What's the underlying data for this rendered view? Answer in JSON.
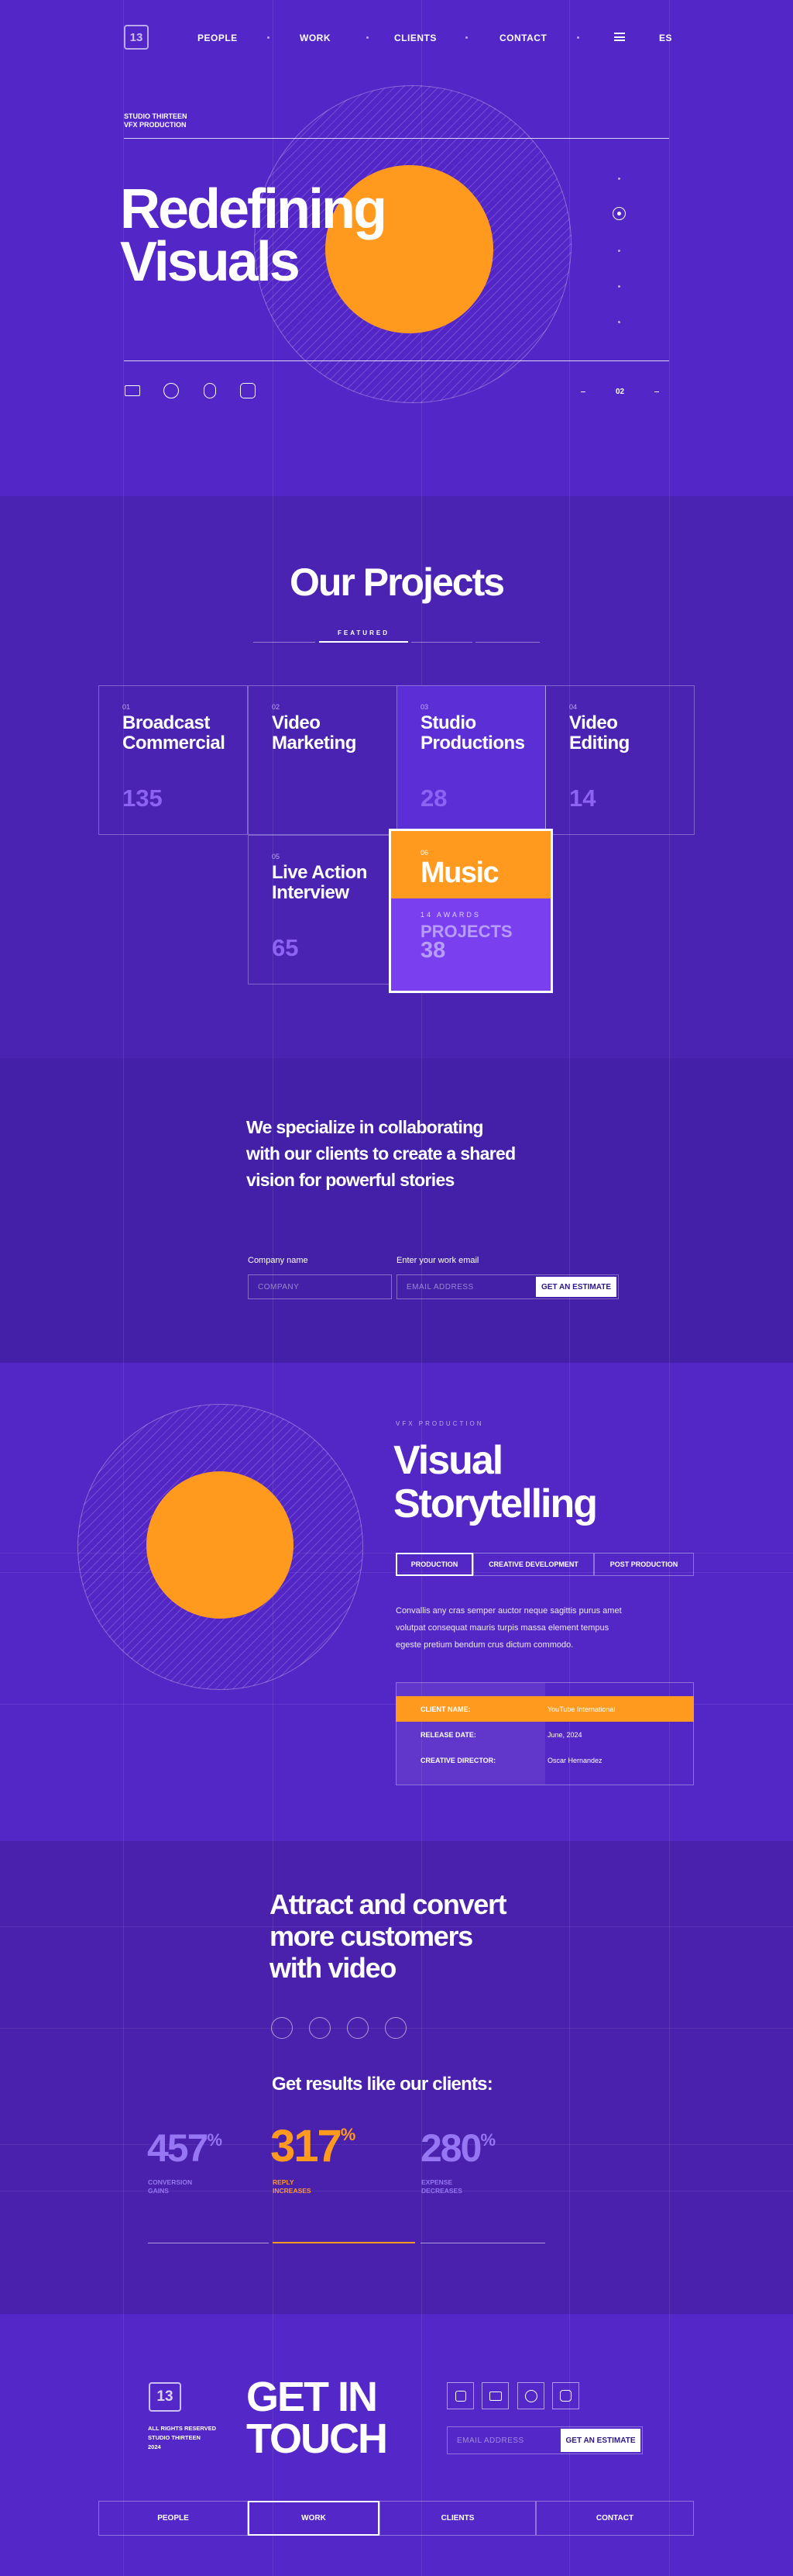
{
  "brand": {
    "logo": "13",
    "lang": "ES"
  },
  "nav": {
    "people": "PEOPLE",
    "work": "WORK",
    "clients": "CLIENTS",
    "contact": "CONTACT"
  },
  "hero": {
    "studio_line1": "STUDIO THIRTEEN",
    "studio_line2": "VFX PRODUCTION",
    "title_line1": "Redefining",
    "title_line2": "Visuals",
    "pager": "02"
  },
  "projects": {
    "heading": "Our Projects",
    "tab_label": "FEATURED",
    "cards": [
      {
        "num": "01",
        "title_line1": "Broadcast",
        "title_line2": "Commercial",
        "count": "135"
      },
      {
        "num": "02",
        "title_line1": "Video",
        "title_line2": "Marketing",
        "count": ""
      },
      {
        "num": "03",
        "title_line1": "Studio",
        "title_line2": "Productions",
        "count": "28"
      },
      {
        "num": "04",
        "title_line1": "Video",
        "title_line2": "Editing",
        "count": "14"
      },
      {
        "num": "05",
        "title_line1": "Live Action",
        "title_line2": "Interview",
        "count": "65"
      }
    ],
    "featured": {
      "num": "06",
      "title": "Music",
      "awards": "14 AWARDS",
      "projects_label": "PROJECTS",
      "projects_count": "38"
    }
  },
  "collab": {
    "text_line1": "We specialize in collaborating",
    "text_line2": "with our clients to create a shared",
    "text_line3": "vision for powerful stories",
    "company_label": "Company name",
    "company_placeholder": "COMPANY",
    "email_label": "Enter your work email",
    "email_placeholder": "EMAIL ADDRESS",
    "button": "GET AN ESTIMATE"
  },
  "story": {
    "eyebrow": "VFX PRODUCTION",
    "title_line1": "Visual",
    "title_line2": "Storytelling",
    "tabs": [
      "PRODUCTION",
      "CREATIVE DEVELOPMENT",
      "POST PRODUCTION"
    ],
    "body_line1": "Convallis any cras semper auctor neque sagittis purus amet",
    "body_line2": "volutpat consequat mauris turpis massa element tempus",
    "body_line3": "egeste pretium bendum crus dictum commodo.",
    "table": [
      {
        "label": "CLIENT NAME:",
        "value": "YouTube International"
      },
      {
        "label": "RELEASE DATE:",
        "value": "June, 2024"
      },
      {
        "label": "CREATIVE DIRECTOR:",
        "value": "Oscar Hernandez"
      }
    ]
  },
  "results": {
    "title_line1": "Attract and convert",
    "title_line2": "more customers",
    "title_line3": "with video",
    "subtitle": "Get results like our clients:",
    "stats": [
      {
        "value": "457",
        "unit": "%",
        "label_line1": "CONVERSION",
        "label_line2": "GAINS"
      },
      {
        "value": "317",
        "unit": "%",
        "label_line1": "REPLY",
        "label_line2": "INCREASES"
      },
      {
        "value": "280",
        "unit": "%",
        "label_line1": "EXPENSE",
        "label_line2": "DECREASES"
      }
    ]
  },
  "footer": {
    "logo": "13",
    "rights_line1": "ALL RIGHTS RESERVED",
    "rights_line2": "STUDIO THIRTEEN",
    "rights_line3": "2024",
    "cta_line1": "GET IN",
    "cta_line2": "TOUCH",
    "email_placeholder": "EMAIL ADDRESS",
    "button": "GET AN ESTIMATE",
    "nav": [
      "PEOPLE",
      "WORK",
      "CLIENTS",
      "CONTACT"
    ]
  },
  "colors": {
    "bg": "#5326c7",
    "accent": "#ff9a1f",
    "card_highlight": "#7a40ef"
  }
}
